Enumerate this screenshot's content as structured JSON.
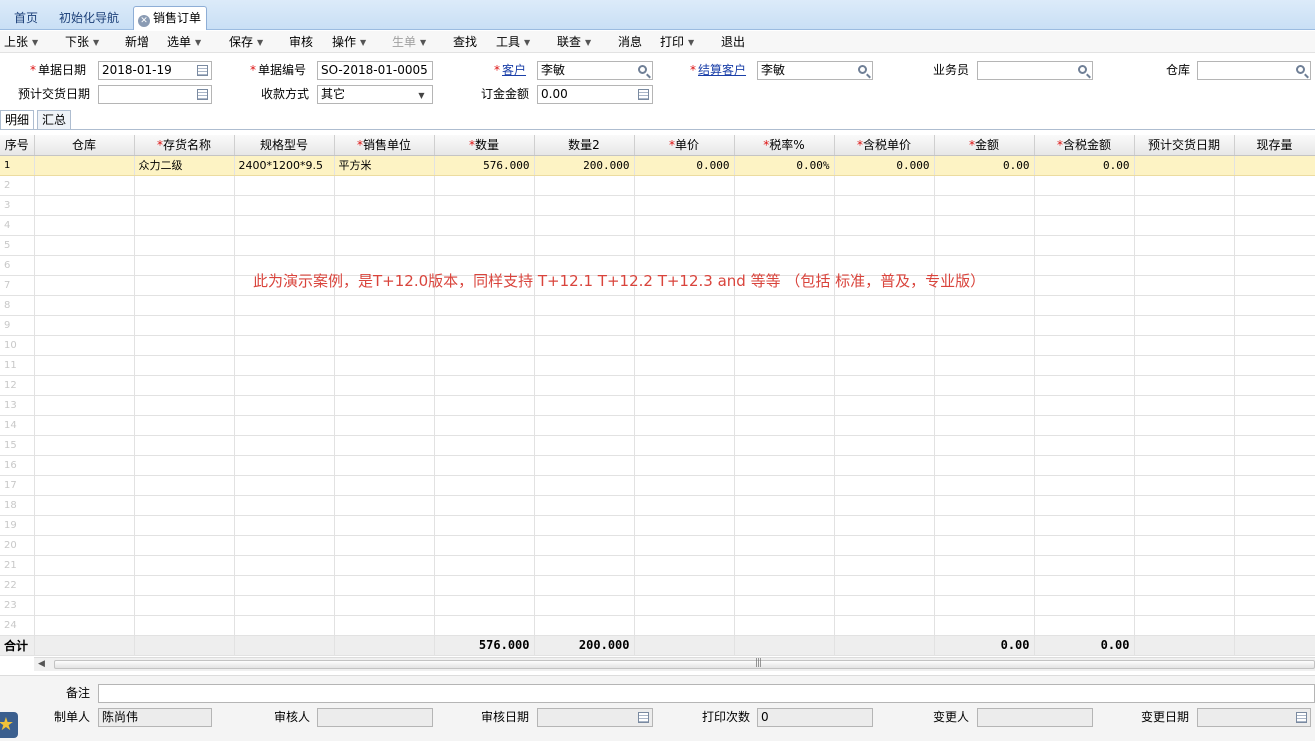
{
  "tabs": [
    {
      "label": "首页"
    },
    {
      "label": "初始化导航"
    },
    {
      "label": "销售订单"
    }
  ],
  "toolbar": [
    {
      "label": "上张",
      "dropdown": true,
      "enabled": true
    },
    {
      "label": "下张",
      "dropdown": true,
      "enabled": true
    },
    {
      "label": "新增",
      "dropdown": false,
      "enabled": true
    },
    {
      "label": "选单",
      "dropdown": true,
      "enabled": true
    },
    {
      "label": "保存",
      "dropdown": true,
      "enabled": true
    },
    {
      "label": "审核",
      "dropdown": false,
      "enabled": true
    },
    {
      "label": "操作",
      "dropdown": true,
      "enabled": true
    },
    {
      "label": "生单",
      "dropdown": true,
      "enabled": false
    },
    {
      "label": "查找",
      "dropdown": false,
      "enabled": true
    },
    {
      "label": "工具",
      "dropdown": true,
      "enabled": true
    },
    {
      "label": "联查",
      "dropdown": true,
      "enabled": true
    },
    {
      "label": "消息",
      "dropdown": false,
      "enabled": true
    },
    {
      "label": "打印",
      "dropdown": true,
      "enabled": true
    },
    {
      "label": "退出",
      "dropdown": false,
      "enabled": true
    }
  ],
  "form": {
    "doc_date": {
      "label": "单据日期",
      "value": "2018-01-19"
    },
    "doc_no": {
      "label": "单据编号",
      "value": "SO-2018-01-0005"
    },
    "customer": {
      "label": "客户",
      "value": "李敏"
    },
    "settle_customer": {
      "label": "结算客户",
      "value": "李敏"
    },
    "salesman": {
      "label": "业务员",
      "value": ""
    },
    "warehouse": {
      "label": "仓库",
      "value": ""
    },
    "delivery_date": {
      "label": "预计交货日期",
      "value": ""
    },
    "payment_method": {
      "label": "收款方式",
      "value": "其它"
    },
    "deposit": {
      "label": "订金金额",
      "value": "0.00"
    }
  },
  "subtabs": [
    {
      "label": "明细"
    },
    {
      "label": "汇总"
    }
  ],
  "grid": {
    "columns": [
      {
        "label": "序号",
        "required": false
      },
      {
        "label": "仓库",
        "required": false
      },
      {
        "label": "存货名称",
        "required": true
      },
      {
        "label": "规格型号",
        "required": false
      },
      {
        "label": "销售单位",
        "required": true
      },
      {
        "label": "数量",
        "required": true
      },
      {
        "label": "数量2",
        "required": false
      },
      {
        "label": "单价",
        "required": true
      },
      {
        "label": "税率%",
        "required": true
      },
      {
        "label": "含税单价",
        "required": true
      },
      {
        "label": "金额",
        "required": true
      },
      {
        "label": "含税金额",
        "required": true
      },
      {
        "label": "预计交货日期",
        "required": false
      },
      {
        "label": "现存量",
        "required": false
      }
    ],
    "rows": [
      [
        "1",
        "",
        "众力二级",
        "2400*1200*9.5",
        "平方米",
        "576.000",
        "200.000",
        "0.000",
        "0.00%",
        "0.000",
        "0.00",
        "0.00",
        "",
        ""
      ]
    ],
    "empty_row_numbers": [
      "2",
      "3",
      "4",
      "5",
      "6",
      "7",
      "8",
      "9",
      "10",
      "11",
      "12",
      "13",
      "14",
      "15",
      "16",
      "17",
      "18",
      "19",
      "20",
      "21",
      "22",
      "23",
      "24"
    ],
    "total": {
      "label": "合计",
      "qty": "576.000",
      "qty2": "200.000",
      "amount": "0.00",
      "tax_amount": "0.00"
    }
  },
  "watermark": "此为演示案例，是T+12.0版本，同样支持 T+12.1  T+12.2 T+12.3 and 等等 （包括 标准，普及，专业版）",
  "footer": {
    "remark": {
      "label": "备注",
      "value": ""
    },
    "maker": {
      "label": "制单人",
      "value": "陈尚伟"
    },
    "auditor": {
      "label": "审核人",
      "value": ""
    },
    "audit_date": {
      "label": "审核日期",
      "value": ""
    },
    "print_count": {
      "label": "打印次数",
      "value": "0"
    },
    "modifier": {
      "label": "变更人",
      "value": ""
    },
    "modify_date": {
      "label": "变更日期",
      "value": ""
    }
  },
  "colors": {
    "required": "#dd1111",
    "selected_row": "#fdf3c4",
    "watermark": "#d9443c",
    "tabbar": "#c9dff5"
  }
}
